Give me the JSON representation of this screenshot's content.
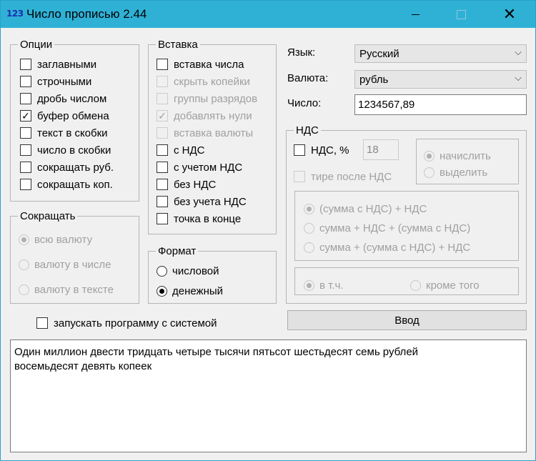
{
  "window": {
    "app_icon": "123",
    "title": "Число прописью 2.44",
    "controls": [
      "minimize-icon",
      "maximize-icon",
      "close-icon"
    ]
  },
  "options": {
    "title": "Опции",
    "items": [
      {
        "label": "заглавными",
        "checked": false
      },
      {
        "label": "строчными",
        "checked": false
      },
      {
        "label": "дробь числом",
        "checked": false
      },
      {
        "label": "буфер обмена",
        "checked": true
      },
      {
        "label": "текст в скобки",
        "checked": false
      },
      {
        "label": "число в скобки",
        "checked": false
      },
      {
        "label": "сокращать руб.",
        "checked": false
      },
      {
        "label": "сокращать коп.",
        "checked": false
      }
    ]
  },
  "insert": {
    "title": "Вставка",
    "items": [
      {
        "label": "вставка числа",
        "checked": false,
        "enabled": true
      },
      {
        "label": "скрыть копейки",
        "checked": false,
        "enabled": false
      },
      {
        "label": "группы разрядов",
        "checked": false,
        "enabled": false
      },
      {
        "label": "добавлять нули",
        "checked": true,
        "enabled": false
      },
      {
        "label": "вставка валюты",
        "checked": false,
        "enabled": false
      },
      {
        "label": "с НДС",
        "checked": false,
        "enabled": true
      },
      {
        "label": "с учетом НДС",
        "checked": false,
        "enabled": true
      },
      {
        "label": "без НДС",
        "checked": false,
        "enabled": true
      },
      {
        "label": "без учета НДС",
        "checked": false,
        "enabled": true
      },
      {
        "label": "точка в конце",
        "checked": false,
        "enabled": true
      }
    ]
  },
  "abbrev": {
    "title": "Сокращать",
    "items": [
      {
        "label": "всю валюту",
        "selected": true
      },
      {
        "label": "валюту в числе",
        "selected": false
      },
      {
        "label": "валюту в тексте",
        "selected": false
      }
    ]
  },
  "format": {
    "title": "Формат",
    "items": [
      {
        "label": "числовой",
        "selected": false
      },
      {
        "label": "денежный",
        "selected": true
      }
    ]
  },
  "autostart": {
    "label": "запускать программу с системой",
    "checked": false
  },
  "language": {
    "label": "Язык:",
    "value": "Русский"
  },
  "currency": {
    "label": "Валюта:",
    "value": "рубль"
  },
  "number": {
    "label": "Число:",
    "value": "1234567,89"
  },
  "vat": {
    "title": "НДС",
    "vat_checkbox": {
      "label": "НДС, %",
      "checked": false
    },
    "rate": "18",
    "calc_mode": [
      {
        "label": "начислить",
        "selected": true
      },
      {
        "label": "выделить",
        "selected": false
      }
    ],
    "dash_after_vat": {
      "label": "тире после НДС",
      "checked": false
    },
    "formulas": [
      {
        "label": "(сумма с НДС) + НДС",
        "selected": true
      },
      {
        "label": "сумма + НДС + (сумма с НДС)",
        "selected": false
      },
      {
        "label": "сумма + (сумма с НДС) + НДС",
        "selected": false
      }
    ],
    "including": [
      {
        "label": "в т.ч.",
        "selected": true
      },
      {
        "label": "кроме того",
        "selected": false
      }
    ]
  },
  "enter_button": "Ввод",
  "output_text": "Один миллион двести тридцать четыре тысячи пятьсот шестьдесят семь рублей\nвосемьдесят девять копеек"
}
